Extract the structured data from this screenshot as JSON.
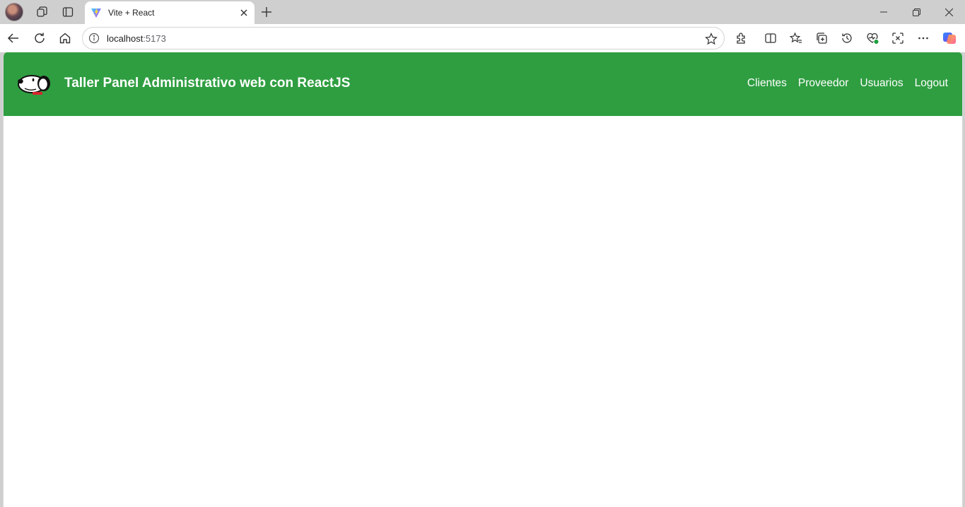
{
  "browser": {
    "tab": {
      "title": "Vite + React",
      "favicon": "vite-logo-icon"
    },
    "new_tab_icon": "plus-icon",
    "address_bar": {
      "host": "localhost",
      "port": ":5173"
    },
    "toolbar_icons": [
      "back-icon",
      "refresh-icon",
      "home-icon",
      "site-info-icon",
      "favorite-star-icon",
      "extensions-icon",
      "split-screen-icon",
      "favorites-icon",
      "collections-icon",
      "history-icon",
      "browser-essentials-icon",
      "screenshot-icon",
      "more-icon",
      "copilot-icon"
    ],
    "window_controls": [
      "minimize-icon",
      "restore-icon",
      "close-icon"
    ]
  },
  "page": {
    "navbar": {
      "brand_title": "Taller Panel Administrativo web con ReactJS",
      "background": "#2f9e41",
      "links": [
        "Clientes",
        "Proveedor",
        "Usuarios",
        "Logout"
      ]
    }
  }
}
